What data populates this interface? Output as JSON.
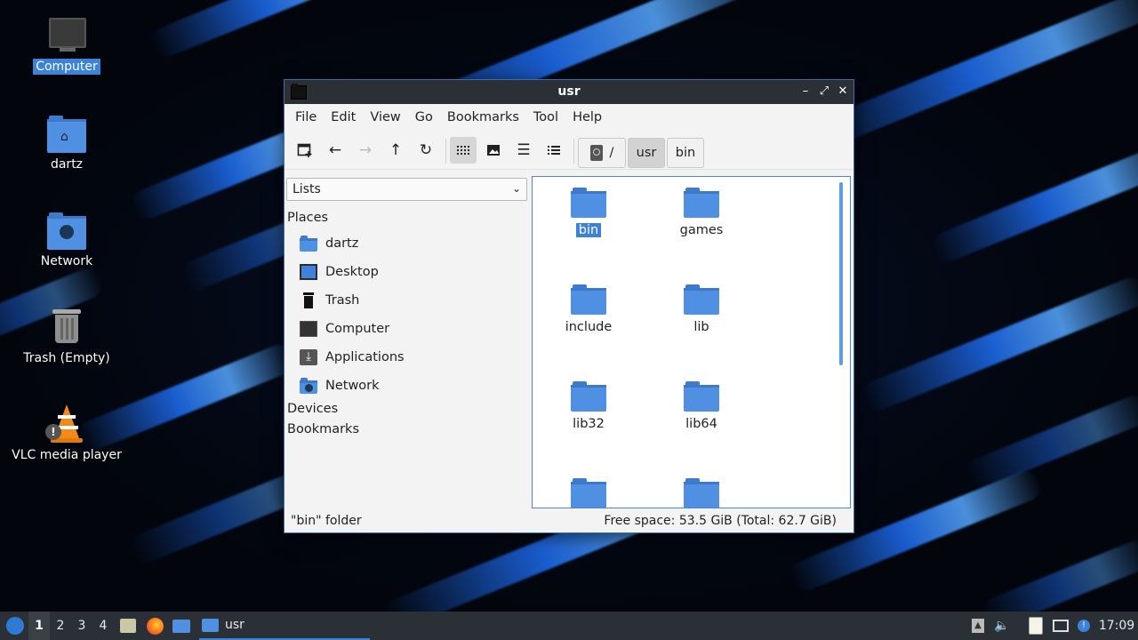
{
  "desktop": {
    "icons": [
      {
        "label": "Computer",
        "selected": true
      },
      {
        "label": "dartz"
      },
      {
        "label": "Network"
      },
      {
        "label": "Trash (Empty)"
      },
      {
        "label": "VLC media player"
      }
    ]
  },
  "window": {
    "title": "usr",
    "menu": [
      "File",
      "Edit",
      "View",
      "Go",
      "Bookmarks",
      "Tool",
      "Help"
    ],
    "toolbar": {
      "new_tab_icon": "new-tab-icon",
      "back_icon": "arrow-left-icon",
      "forward_icon": "arrow-right-icon",
      "up_icon": "arrow-up-icon",
      "reload_icon": "reload-icon",
      "view_modes": [
        "icon-view",
        "thumbnail-view",
        "compact-view",
        "detailed-list-view"
      ]
    },
    "path_bar": {
      "root": "/",
      "segments": [
        "usr",
        "bin"
      ],
      "current": "usr"
    },
    "sidebar": {
      "mode": "Lists",
      "sections": {
        "places": "Places",
        "devices": "Devices",
        "bookmarks": "Bookmarks"
      },
      "places": [
        "dartz",
        "Desktop",
        "Trash",
        "Computer",
        "Applications",
        "Network"
      ]
    },
    "files": [
      "bin",
      "games",
      "include",
      "lib",
      "lib32",
      "lib64"
    ],
    "selected_file": "bin",
    "status": {
      "left": "\"bin\" folder",
      "right": "Free space: 53.5 GiB (Total: 62.7 GiB)"
    }
  },
  "taskbar": {
    "workspaces": [
      "1",
      "2",
      "3",
      "4"
    ],
    "current_workspace": "1",
    "task": "usr",
    "clock": "17:09"
  },
  "colors": {
    "accent": "#3b82d8",
    "folder": "#4f90e3",
    "titlebar": "#2b2f36"
  }
}
